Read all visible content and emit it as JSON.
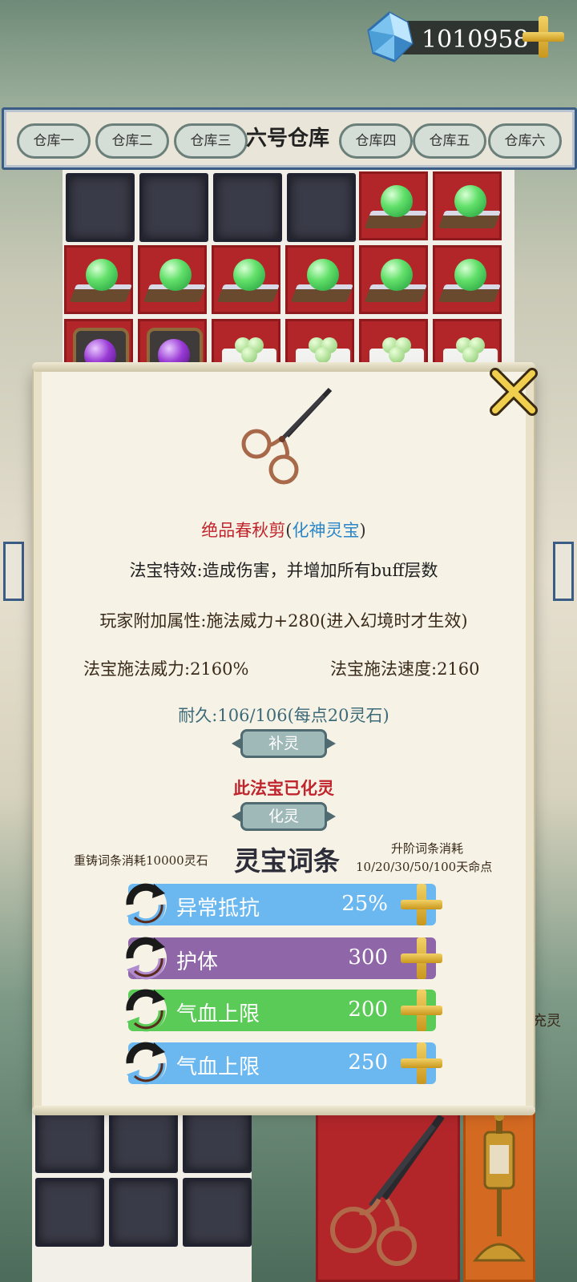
{
  "currency": {
    "amount": "1010958",
    "icon": "crystal-icon",
    "add_icon": "plus-icon"
  },
  "warehouse": {
    "tabs": [
      "仓库一",
      "仓库二",
      "仓库三",
      "六号仓库",
      "仓库四",
      "仓库五",
      "仓库六"
    ],
    "active_index": 3
  },
  "popup": {
    "item_name": "绝品春秋剪",
    "item_grade": "化神灵宝",
    "paren_open": "(",
    "paren_close": ")",
    "effect": "法宝特效:造成伤害，并增加所有buff层数",
    "player_attr": "玩家附加属性:施法威力+280(进入幻境时才生效)",
    "cast_power": "法宝施法威力:2160%",
    "cast_speed": "法宝施法速度:2160",
    "durability": "耐久:106/106(每点20灵石)",
    "replenish_btn": "补灵",
    "awakened_text": "此法宝已化灵",
    "awaken_btn": "化灵",
    "reforge_cost": "重铸词条消耗10000灵石",
    "entries_title": "灵宝词条",
    "upgrade_cost_label": "升阶词条消耗",
    "upgrade_cost_values": "10/20/30/50/100天命点",
    "affixes": [
      {
        "label": "异常抵抗",
        "value": "25%",
        "color": "#6bb8f0",
        "cycle": "#6bb8f0"
      },
      {
        "label": "护体",
        "value": "300",
        "color": "#8f67a8",
        "cycle": "#b08bd0"
      },
      {
        "label": "气血上限",
        "value": "200",
        "color": "#5acb56",
        "cycle": "#5acb56"
      },
      {
        "label": "气血上限",
        "value": "250",
        "color": "#6bb8f0",
        "cycle": "#6bb8f0"
      }
    ]
  },
  "side_label": "充灵",
  "colors": {
    "frame_blue": "#3b5c84",
    "slot_red": "#b2262a",
    "slot_empty": "#3a3b48"
  }
}
